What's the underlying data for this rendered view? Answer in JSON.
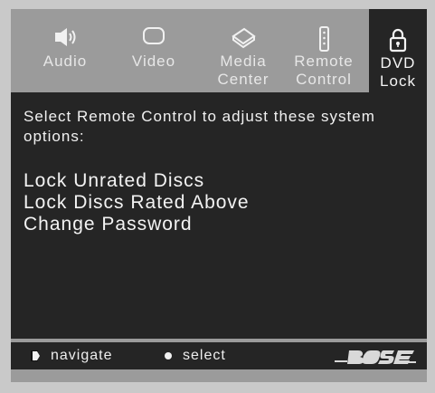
{
  "tabs": [
    {
      "name": "audio",
      "label": "Audio",
      "icon": "speaker-icon"
    },
    {
      "name": "video",
      "label": "Video",
      "icon": "tv-icon"
    },
    {
      "name": "media-center",
      "label": "Media\nCenter",
      "icon": "media-center-icon"
    },
    {
      "name": "remote-control",
      "label": "Remote\nControl",
      "icon": "remote-icon"
    },
    {
      "name": "dvd-lock",
      "label": "DVD\nLock",
      "icon": "lock-icon",
      "active": true
    }
  ],
  "content": {
    "instruction": "Select Remote Control to adjust these system options:",
    "options": [
      "Lock Unrated Discs",
      "Lock Discs Rated Above",
      "Change Password"
    ]
  },
  "footer": {
    "navigate_label": "navigate",
    "select_label": "select"
  },
  "brand": "BOSE",
  "colors": {
    "frame": "#9b9b9b",
    "panel": "#252525",
    "text": "#f1f1f1",
    "tab_text": "#e7e7e7"
  }
}
